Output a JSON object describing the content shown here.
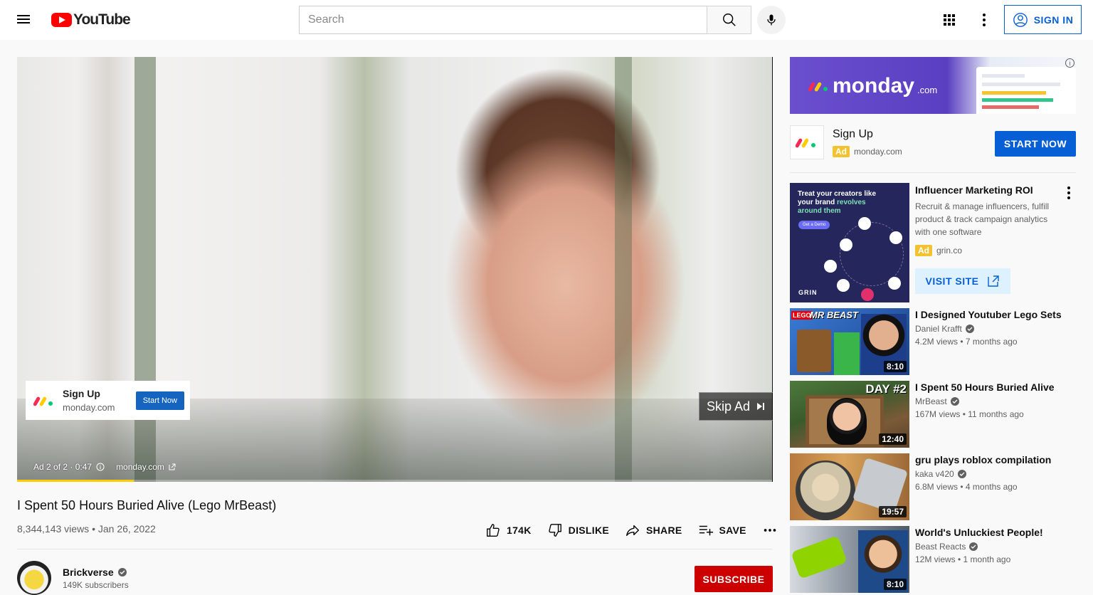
{
  "header": {
    "logo_text": "YouTube",
    "search_placeholder": "Search",
    "signin_label": "SIGN IN"
  },
  "player": {
    "ad_card": {
      "title": "Sign Up",
      "domain": "monday.com",
      "button": "Start Now"
    },
    "skip_label": "Skip Ad",
    "ad_info": "Ad 2 of 2 · 0:47",
    "ad_domain": "monday.com",
    "ad_progress_fraction": 0.155
  },
  "video": {
    "title": "I Spent 50 Hours Buried Alive (Lego MrBeast)",
    "meta": "8,344,143 views • Jan 26, 2022",
    "actions": {
      "like": "174K",
      "dislike": "DISLIKE",
      "share": "SHARE",
      "save": "SAVE"
    },
    "channel": {
      "name": "Brickverse",
      "subs": "149K subscribers"
    },
    "subscribe": "SUBSCRIBE"
  },
  "sidebar": {
    "banner": {
      "brand": "monday",
      "suffix": ".com"
    },
    "signup": {
      "title": "Sign Up",
      "badge": "Ad",
      "domain": "monday.com",
      "button": "START NOW"
    },
    "promo": {
      "title": "Influencer Marketing ROI",
      "desc": "Recruit & manage influencers, fulfill product & track campaign analytics with one software",
      "badge": "Ad",
      "domain": "grin.co",
      "button": "VISIT SITE",
      "thumb_line1": "Treat your creators like your brand",
      "thumb_line2": "revolves around them",
      "thumb_demo": "Get a Demo",
      "thumb_brand": "GRIN"
    },
    "recommendations": [
      {
        "title": "I Designed Youtuber Lego Sets",
        "channel": "Daniel Krafft",
        "stats": "4.2M views • 7 months ago",
        "duration": "8:10",
        "thumb_caption": "MR BEAST"
      },
      {
        "title": "I Spent 50 Hours Buried Alive",
        "channel": "MrBeast",
        "stats": "167M views • 11 months ago",
        "duration": "12:40",
        "thumb_caption": "DAY #2"
      },
      {
        "title": "gru plays roblox compilation",
        "channel": "kaka v420",
        "stats": "6.8M views • 4 months ago",
        "duration": "19:57"
      },
      {
        "title": "World's Unluckiest People!",
        "channel": "Beast Reacts",
        "stats": "12M views • 1 month ago",
        "duration": "8:10"
      }
    ]
  },
  "colors": {
    "brand_red": "#ff0000",
    "link_blue": "#065fd4",
    "ad_yellow": "#f2c230",
    "subscribe_red": "#cc0000"
  }
}
